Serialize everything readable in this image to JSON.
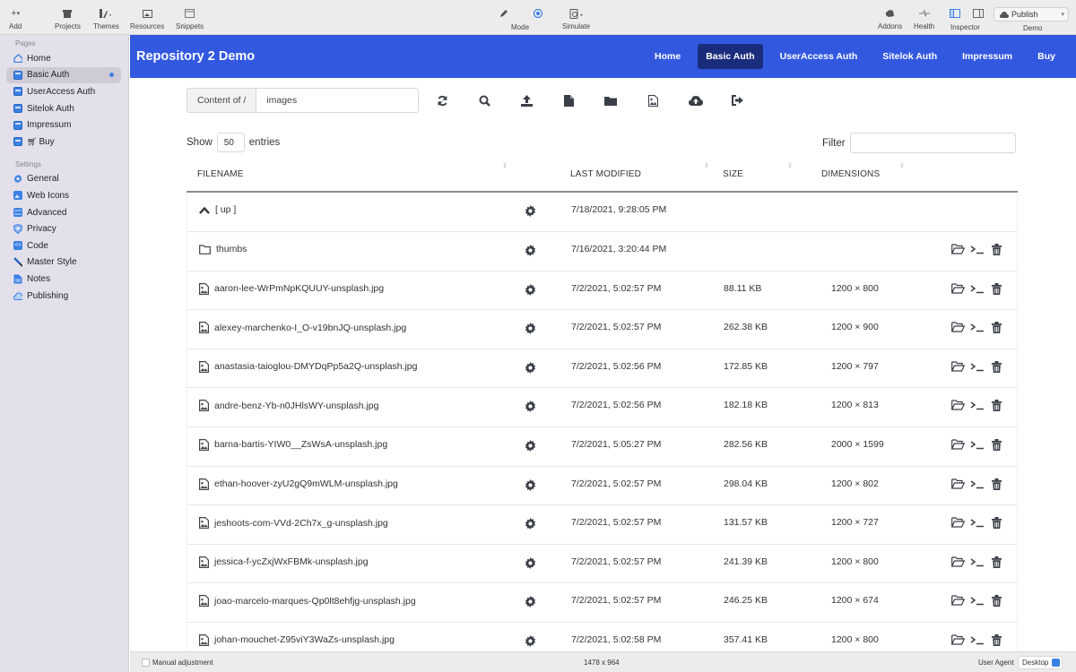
{
  "toolbar": {
    "add": "Add",
    "projects": "Projects",
    "themes": "Themes",
    "resources": "Resources",
    "snippets": "Snippets",
    "mode": "Mode",
    "simulate": "Simulate",
    "addons": "Addons",
    "health": "Health",
    "inspector": "Inspector",
    "publish": "Publish",
    "project_name": "Demo"
  },
  "sidebar": {
    "pages_heading": "Pages",
    "pages": [
      {
        "label": "Home",
        "icon": "home-icon"
      },
      {
        "label": "Basic Auth",
        "icon": "page-icon",
        "active": true
      },
      {
        "label": "UserAccess Auth",
        "icon": "page-icon"
      },
      {
        "label": "Sitelok Auth",
        "icon": "page-icon"
      },
      {
        "label": "Impressum",
        "icon": "page-icon"
      },
      {
        "label": "Buy",
        "icon": "page-icon",
        "prefix_icon": "cart-icon"
      }
    ],
    "settings_heading": "Settings",
    "settings": [
      {
        "label": "General",
        "icon": "gear-icon"
      },
      {
        "label": "Web Icons",
        "icon": "image-icon"
      },
      {
        "label": "Advanced",
        "icon": "sliders-icon"
      },
      {
        "label": "Privacy",
        "icon": "shield-icon"
      },
      {
        "label": "Code",
        "icon": "code-icon"
      },
      {
        "label": "Master Style",
        "icon": "brush-icon"
      },
      {
        "label": "Notes",
        "icon": "notes-icon"
      },
      {
        "label": "Publishing",
        "icon": "cloud-icon"
      }
    ]
  },
  "site": {
    "brand": "Repository 2 Demo",
    "nav": [
      {
        "label": "Home"
      },
      {
        "label": "Basic Auth",
        "active": true
      },
      {
        "label": "UserAccess Auth"
      },
      {
        "label": "Sitelok Auth"
      },
      {
        "label": "Impressum"
      },
      {
        "label": "Buy"
      }
    ]
  },
  "browser": {
    "path_prefix": "Content of /",
    "path_value": "images",
    "tools": [
      "refresh-icon",
      "search-icon",
      "upload-icon",
      "new-file-icon",
      "new-folder-icon",
      "image-file-icon",
      "cloud-upload-icon",
      "logout-icon"
    ],
    "show_label": "Show",
    "entries_value": "50",
    "entries_label": "entries",
    "filter_label": "Filter",
    "filter_value": "",
    "columns": [
      "FILENAME",
      "LAST MODIFIED",
      "SIZE",
      "DIMENSIONS"
    ],
    "rows": [
      {
        "type": "up",
        "name": "[ up ]",
        "modified": "7/18/2021, 9:28:05 PM",
        "size": "",
        "dimensions": "",
        "actions": false
      },
      {
        "type": "folder",
        "name": "thumbs",
        "modified": "7/16/2021, 3:20:44 PM",
        "size": "",
        "dimensions": "",
        "actions": true
      },
      {
        "type": "image",
        "name": "aaron-lee-WrPmNpKQUUY-unsplash.jpg",
        "modified": "7/2/2021, 5:02:57 PM",
        "size": "88.11 KB",
        "dimensions": "1200 × 800",
        "actions": true
      },
      {
        "type": "image",
        "name": "alexey-marchenko-I_O-v19bnJQ-unsplash.jpg",
        "modified": "7/2/2021, 5:02:57 PM",
        "size": "262.38 KB",
        "dimensions": "1200 × 900",
        "actions": true
      },
      {
        "type": "image",
        "name": "anastasia-taioglou-DMYDqPp5a2Q-unsplash.jpg",
        "modified": "7/2/2021, 5:02:56 PM",
        "size": "172.85 KB",
        "dimensions": "1200 × 797",
        "actions": true
      },
      {
        "type": "image",
        "name": "andre-benz-Yb-n0JHlsWY-unsplash.jpg",
        "modified": "7/2/2021, 5:02:56 PM",
        "size": "182.18 KB",
        "dimensions": "1200 × 813",
        "actions": true
      },
      {
        "type": "image",
        "name": "barna-bartis-YIW0__ZsWsA-unsplash.jpg",
        "modified": "7/2/2021, 5:05:27 PM",
        "size": "282.56 KB",
        "dimensions": "2000 × 1599",
        "actions": true
      },
      {
        "type": "image",
        "name": "ethan-hoover-zyU2gQ9mWLM-unsplash.jpg",
        "modified": "7/2/2021, 5:02:57 PM",
        "size": "298.04 KB",
        "dimensions": "1200 × 802",
        "actions": true
      },
      {
        "type": "image",
        "name": "jeshoots-com-VVd-2Ch7x_g-unsplash.jpg",
        "modified": "7/2/2021, 5:02:57 PM",
        "size": "131.57 KB",
        "dimensions": "1200 × 727",
        "actions": true
      },
      {
        "type": "image",
        "name": "jessica-f-ycZxjWxFBMk-unsplash.jpg",
        "modified": "7/2/2021, 5:02:57 PM",
        "size": "241.39 KB",
        "dimensions": "1200 × 800",
        "actions": true
      },
      {
        "type": "image",
        "name": "joao-marcelo-marques-Qp0lt8ehfjg-unsplash.jpg",
        "modified": "7/2/2021, 5:02:57 PM",
        "size": "246.25 KB",
        "dimensions": "1200 × 674",
        "actions": true
      },
      {
        "type": "image",
        "name": "johan-mouchet-Z95viY3WaZs-unsplash.jpg",
        "modified": "7/2/2021, 5:02:58 PM",
        "size": "357.41 KB",
        "dimensions": "1200 × 800",
        "actions": true
      }
    ]
  },
  "statusbar": {
    "manual_adjustment": "Manual adjustment",
    "viewport_size": "1478 x 964",
    "user_agent_label": "User Agent",
    "user_agent_value": "Desktop"
  }
}
